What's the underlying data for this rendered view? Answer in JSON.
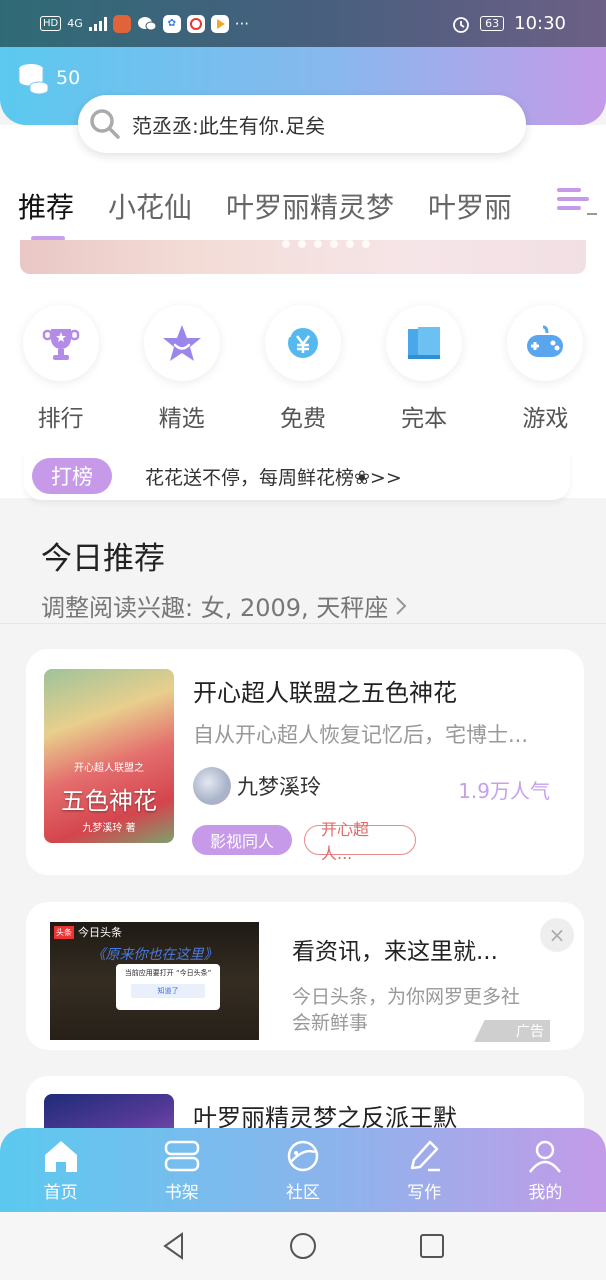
{
  "status_bar": {
    "left_indicators": [
      "HD",
      "4G"
    ],
    "time": "10:30",
    "battery": "63"
  },
  "header": {
    "coins": "50",
    "search_placeholder": "范丞丞:此生有你.足矣"
  },
  "tabs": [
    {
      "label": "推荐",
      "active": true
    },
    {
      "label": "小花仙",
      "active": false
    },
    {
      "label": "叶罗丽精灵梦",
      "active": false
    },
    {
      "label": "叶罗丽",
      "active": false
    }
  ],
  "categories": [
    {
      "label": "排行",
      "icon": "trophy-icon",
      "color": "#b58be8"
    },
    {
      "label": "精选",
      "icon": "star-icon",
      "color": "#9b86ec"
    },
    {
      "label": "免费",
      "icon": "yen-icon",
      "color": "#55b9f0"
    },
    {
      "label": "完本",
      "icon": "book-icon",
      "color": "#4aa8ea"
    },
    {
      "label": "游戏",
      "icon": "gamepad-icon",
      "color": "#5aa6ee"
    }
  ],
  "rank_strip": {
    "badge": "打榜",
    "text": "花花送不停，每周鲜花榜❀>>"
  },
  "today": {
    "title": "今日推荐",
    "subtitle": "调整阅读兴趣: 女, 2009, 天秤座"
  },
  "book1": {
    "title": "开心超人联盟之五色神花",
    "desc": "自从开心超人恢复记忆后，宅博士...",
    "author": "九梦溪玲",
    "popularity": "1.9万人气",
    "tags": [
      "影视同人",
      "开心超人..."
    ],
    "cover_title": "五色神花",
    "cover_top": "开心超人联盟之",
    "cover_bottom": "九梦溪玲 著"
  },
  "ad": {
    "title": "看资讯，来这里就...",
    "desc": "今日头条，为你网罗更多社会新鲜事",
    "badge": "广告",
    "image_brand": "今日头条",
    "image_brand_tag": "头条",
    "image_headline": "《原来你也在这里》",
    "image_dialog": "当前应用要打开 “今日头条”",
    "image_dialog_button": "知道了"
  },
  "book2": {
    "title": "叶罗丽精灵梦之反派王默"
  },
  "bottom_nav": [
    {
      "label": "首页",
      "icon": "home-icon"
    },
    {
      "label": "书架",
      "icon": "bookshelf-icon"
    },
    {
      "label": "社区",
      "icon": "planet-icon"
    },
    {
      "label": "写作",
      "icon": "pen-icon"
    },
    {
      "label": "我的",
      "icon": "user-icon"
    }
  ],
  "colors": {
    "accent_purple": "#c69ae8",
    "gradient_start": "#5bc9ef",
    "gradient_end": "#c49be8"
  }
}
